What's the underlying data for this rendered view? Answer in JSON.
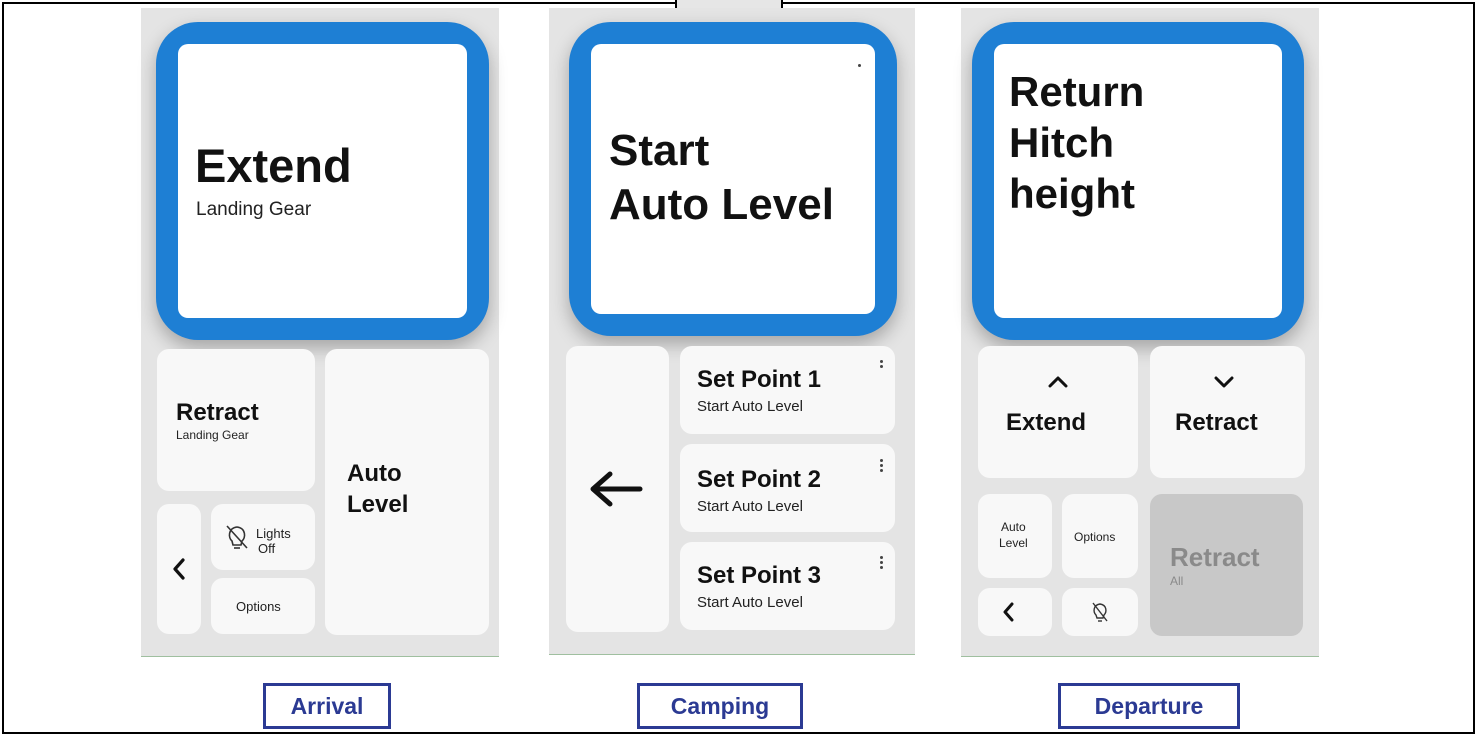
{
  "panels": {
    "arrival": {
      "hero": {
        "title": "Extend",
        "subtitle": "Landing Gear"
      },
      "retract": {
        "title": "Retract",
        "subtitle": "Landing Gear"
      },
      "auto_level": {
        "line1": "Auto",
        "line2": "Level"
      },
      "lights": {
        "line1": "Lights",
        "line2": "Off"
      },
      "options": "Options",
      "caption": "Arrival"
    },
    "camping": {
      "hero": {
        "line1": "Start",
        "line2": "Auto Level"
      },
      "set_points": [
        {
          "title": "Set Point 1",
          "subtitle": "Start Auto Level"
        },
        {
          "title": "Set Point 2",
          "subtitle": "Start Auto Level"
        },
        {
          "title": "Set Point 3",
          "subtitle": "Start Auto Level"
        }
      ],
      "caption": "Camping"
    },
    "departure": {
      "hero": {
        "line1": "Return",
        "line2": "Hitch",
        "line3": "height"
      },
      "extend": "Extend",
      "retract": "Retract",
      "auto_level": {
        "line1": "Auto",
        "line2": "Level"
      },
      "options": "Options",
      "retract_all": {
        "title": "Retract",
        "subtitle": "All"
      },
      "caption": "Departure"
    }
  },
  "colors": {
    "accent": "#1e7fd4",
    "caption": "#2b3a93",
    "panel_bg": "#e4e4e4",
    "tile_bg": "#f8f8f8",
    "disabled_tile": "#c8c8c8"
  },
  "icons": [
    "lightbulb-off-icon",
    "chevron-left-icon",
    "arrow-left-icon",
    "chevron-up-icon",
    "chevron-down-icon",
    "kebab-menu-icon"
  ]
}
